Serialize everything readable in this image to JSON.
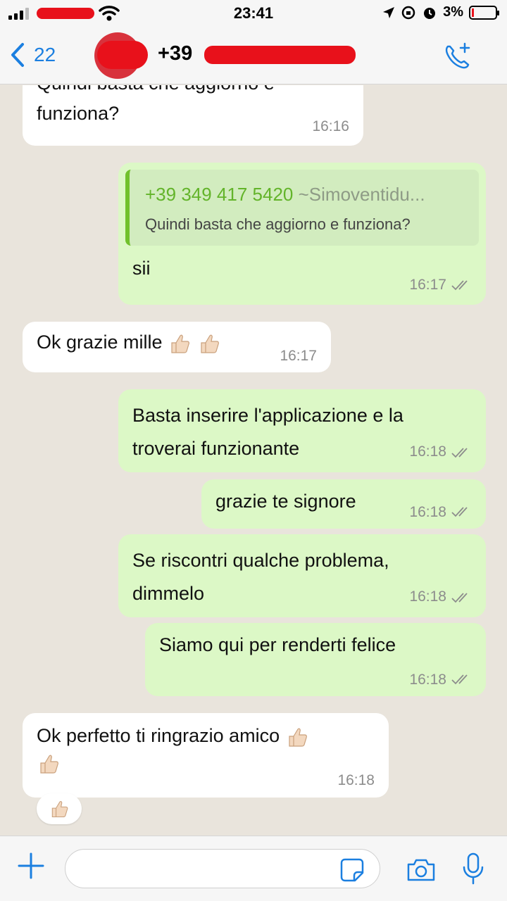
{
  "status_bar": {
    "time": "23:41",
    "battery": "3%"
  },
  "header": {
    "back_count": "22",
    "contact_prefix": "+39"
  },
  "messages": [
    {
      "direction": "in",
      "text_line1": "Quindi basta che aggiorno e",
      "text_line2": "funziona?",
      "time": "16:16"
    },
    {
      "direction": "out",
      "quote_number": "+39 349 417 5420",
      "quote_name": "~Simoventidu...",
      "quote_text": "Quindi basta che aggiorno e funziona?",
      "text": "sii",
      "time": "16:17"
    },
    {
      "direction": "in",
      "text": "Ok grazie mille",
      "time": "16:17"
    },
    {
      "direction": "out",
      "text_line1": "Basta inserire l'applicazione e la",
      "text_line2": "troverai funzionante",
      "time": "16:18"
    },
    {
      "direction": "out",
      "text": "grazie te signore",
      "time": "16:18"
    },
    {
      "direction": "out",
      "text_line1": "Se riscontri qualche problema,",
      "text_line2": "dimmelo",
      "time": "16:18"
    },
    {
      "direction": "out",
      "text": "Siamo qui per renderti felice",
      "time": "16:18"
    },
    {
      "direction": "in",
      "text": "Ok perfetto ti ringrazio amico",
      "time": "16:18"
    }
  ],
  "icons": {
    "back": "chevron-left-icon",
    "call_add": "phone-plus-icon",
    "attach": "plus-icon",
    "sticker": "sticker-icon",
    "camera": "camera-icon",
    "mic": "microphone-icon",
    "reaction": "thumbs-up-icon"
  },
  "colors": {
    "incoming_bubble": "#ffffff",
    "outgoing_bubble": "#dcf8c6",
    "accent_blue": "#1b7fe0",
    "quote_green": "#63b42a"
  }
}
